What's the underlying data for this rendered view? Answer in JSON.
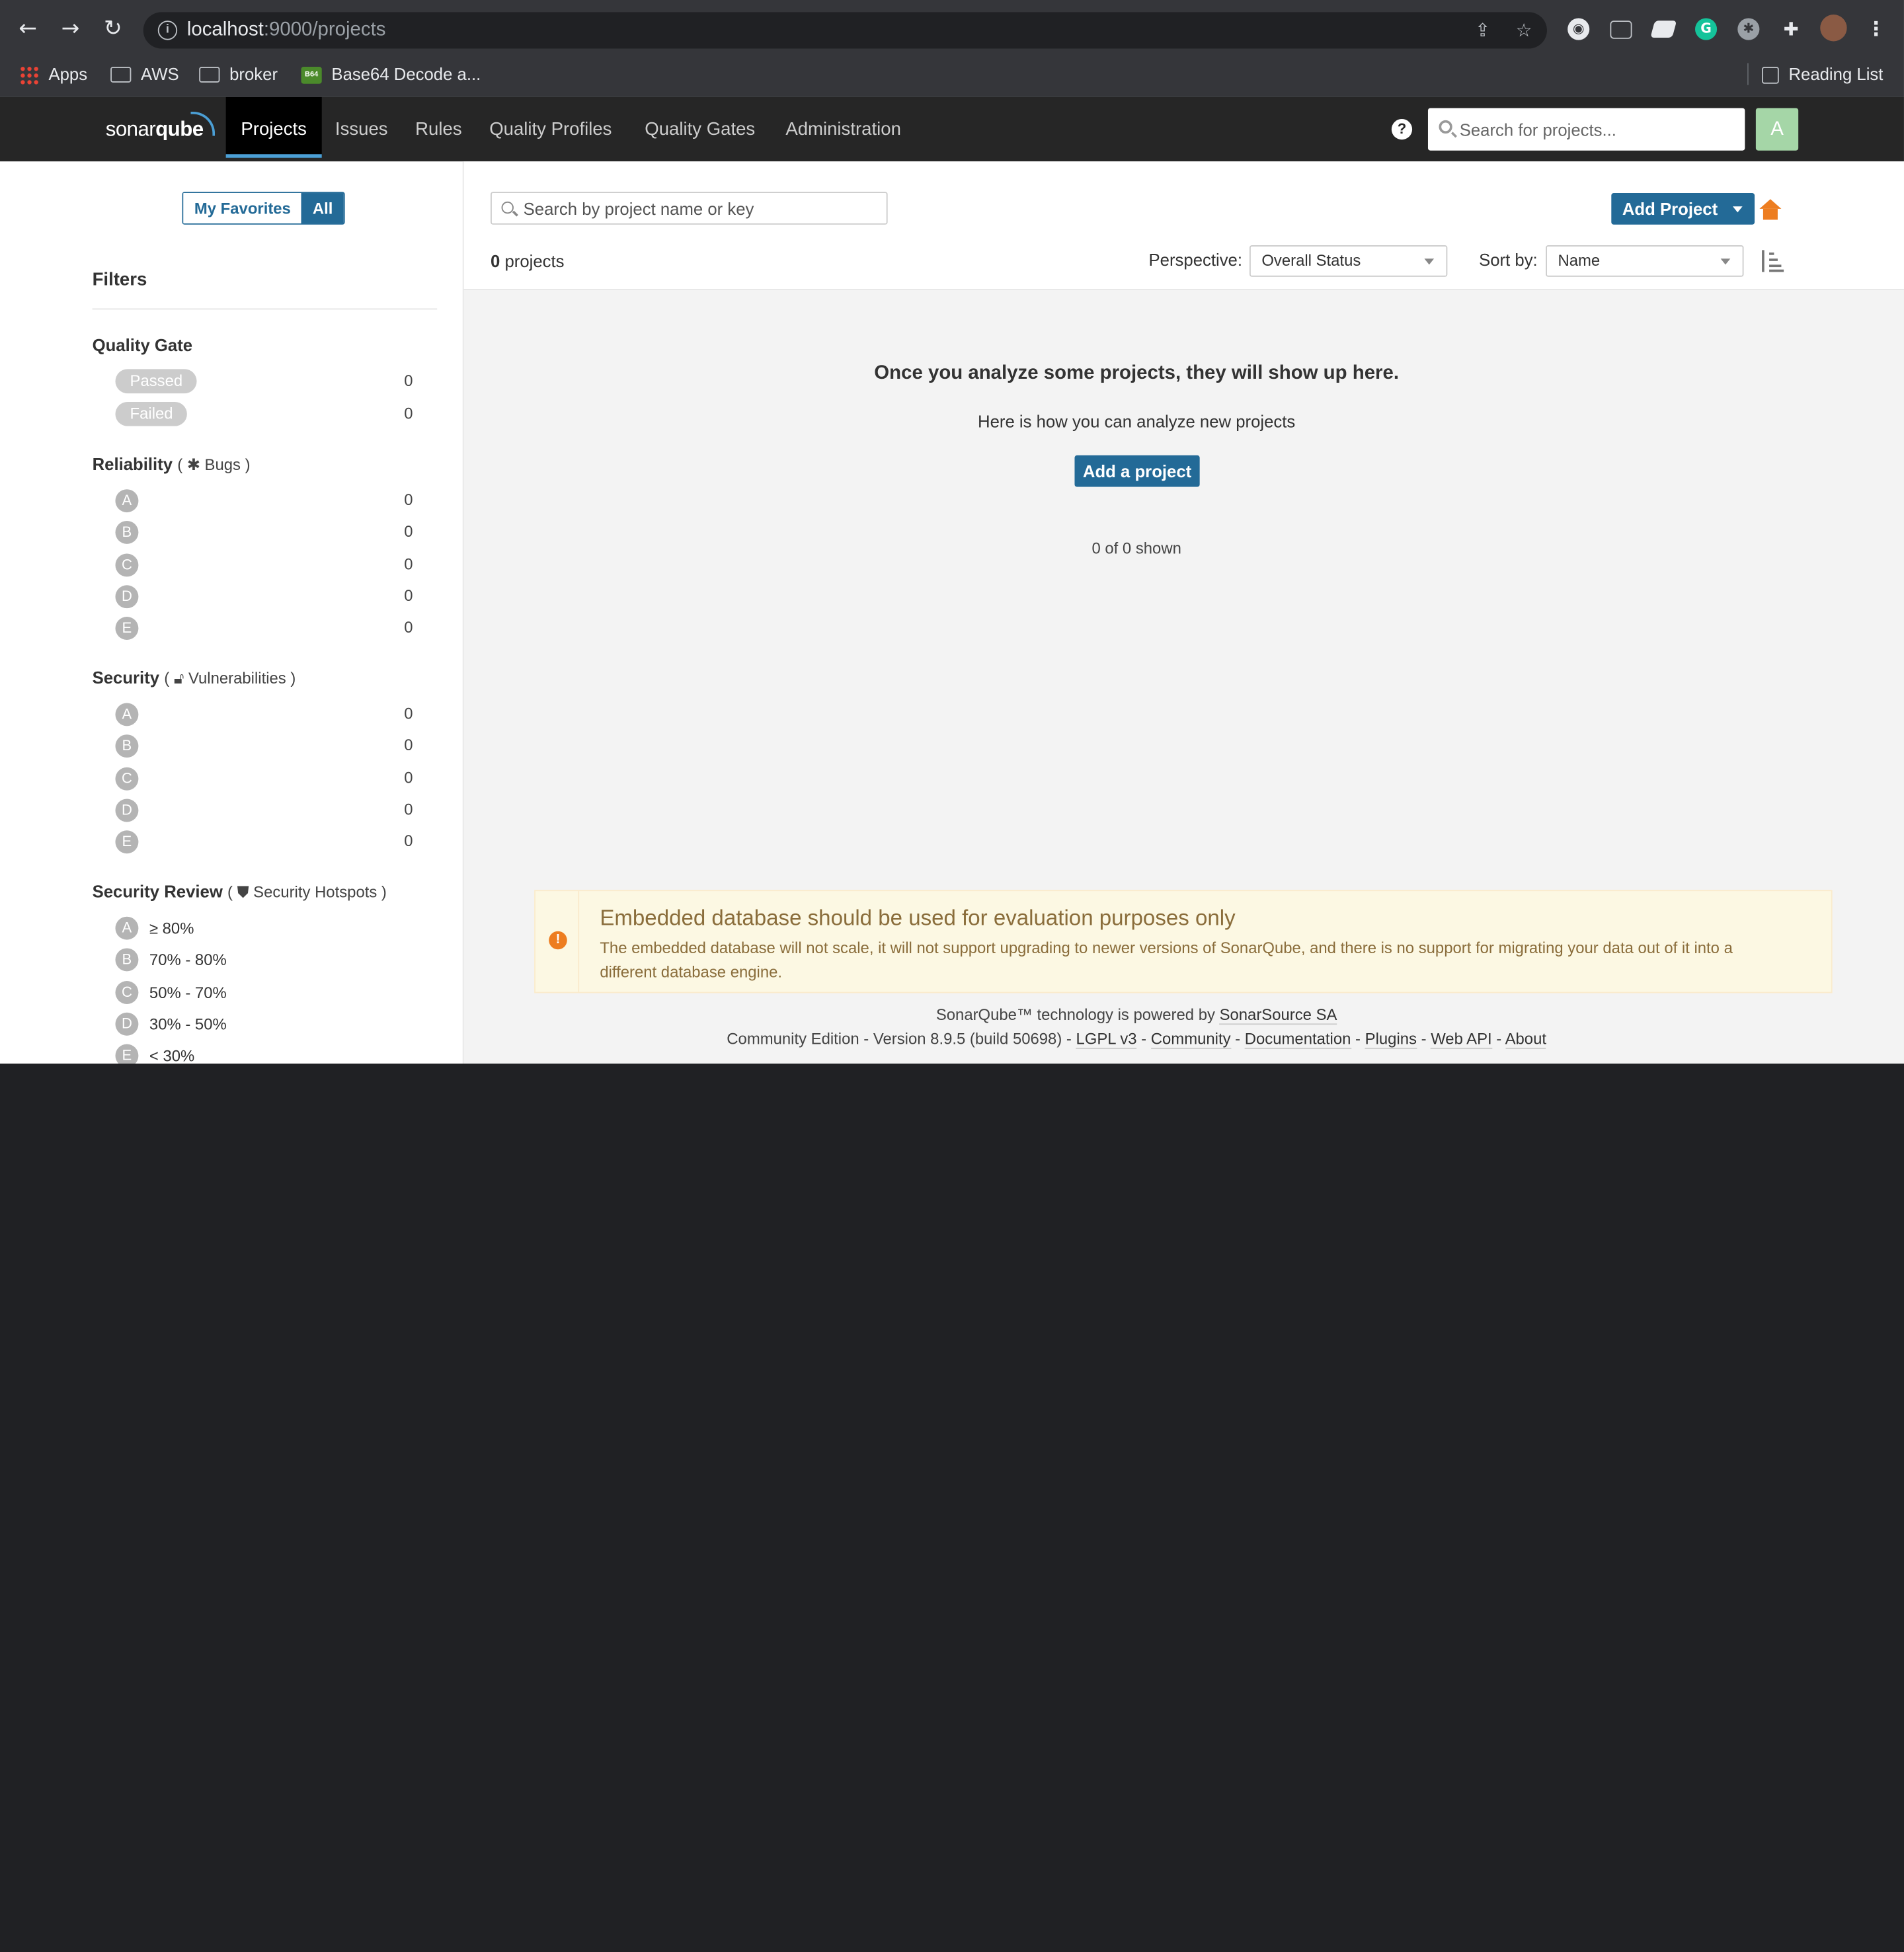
{
  "browser": {
    "url_host": "localhost",
    "url_path": ":9000/projects",
    "bookmarks": [
      "Apps",
      "AWS",
      "broker",
      "Base64 Decode a..."
    ],
    "reading_list": "Reading List"
  },
  "sonar_nav": {
    "logo_regular": "sonar",
    "logo_bold": "qube",
    "links": [
      "Projects",
      "Issues",
      "Rules",
      "Quality Profiles",
      "Quality Gates",
      "Administration"
    ],
    "search_placeholder": "Search for projects...",
    "avatar": "A",
    "help": "?"
  },
  "sidebar": {
    "my_favorites": "My Favorites",
    "all": "All",
    "filters_title": "Filters",
    "quality_gate": {
      "title": "Quality Gate",
      "items": [
        {
          "label": "Passed",
          "count": "0"
        },
        {
          "label": "Failed",
          "count": "0"
        }
      ]
    },
    "reliability": {
      "title": "Reliability",
      "sub": "Bugs",
      "ratings": [
        "A",
        "B",
        "C",
        "D",
        "E"
      ],
      "counts": [
        "0",
        "0",
        "0",
        "0",
        "0"
      ]
    },
    "security": {
      "title": "Security",
      "sub": "Vulnerabilities",
      "ratings": [
        "A",
        "B",
        "C",
        "D",
        "E"
      ],
      "counts": [
        "0",
        "0",
        "0",
        "0",
        "0"
      ]
    },
    "security_review": {
      "title": "Security Review",
      "sub": "Security Hotspots",
      "ratings": [
        "A",
        "B",
        "C",
        "D",
        "E"
      ],
      "labels": [
        "≥ 80%",
        "70% - 80%",
        "50% - 70%",
        "30% - 50%",
        "< 30%"
      ]
    }
  },
  "main": {
    "search_placeholder": "Search by project name or key",
    "add_project": "Add Project",
    "project_count": "0",
    "projects_word": " projects",
    "perspective_label": "Perspective:",
    "perspective_value": "Overall Status",
    "sort_label": "Sort by:",
    "sort_value": "Name",
    "empty_title": "Once you analyze some projects, they will show up here.",
    "empty_sub": "Here is how you can analyze new projects",
    "add_a_project": "Add a project",
    "shown": "0 of 0 shown"
  },
  "warning": {
    "title": "Embedded database should be used for evaluation purposes only",
    "text": "The embedded database will not scale, it will not support upgrading to newer versions of SonarQube, and there is no support for migrating your data out of it into a different database engine."
  },
  "footer": {
    "powered_prefix": "SonarQube™ technology is powered by ",
    "powered_link": "SonarSource SA",
    "edition": "Community Edition - Version 8.9.5 (build 50698) - ",
    "links": [
      "LGPL v3",
      "Community",
      "Documentation",
      "Plugins",
      "Web API",
      "About"
    ],
    "sep": " - "
  },
  "colors": {
    "accent": "#236a97",
    "home": "#ed7d20",
    "nav_bg": "#262626",
    "warn_bg": "#fcf8e3"
  }
}
